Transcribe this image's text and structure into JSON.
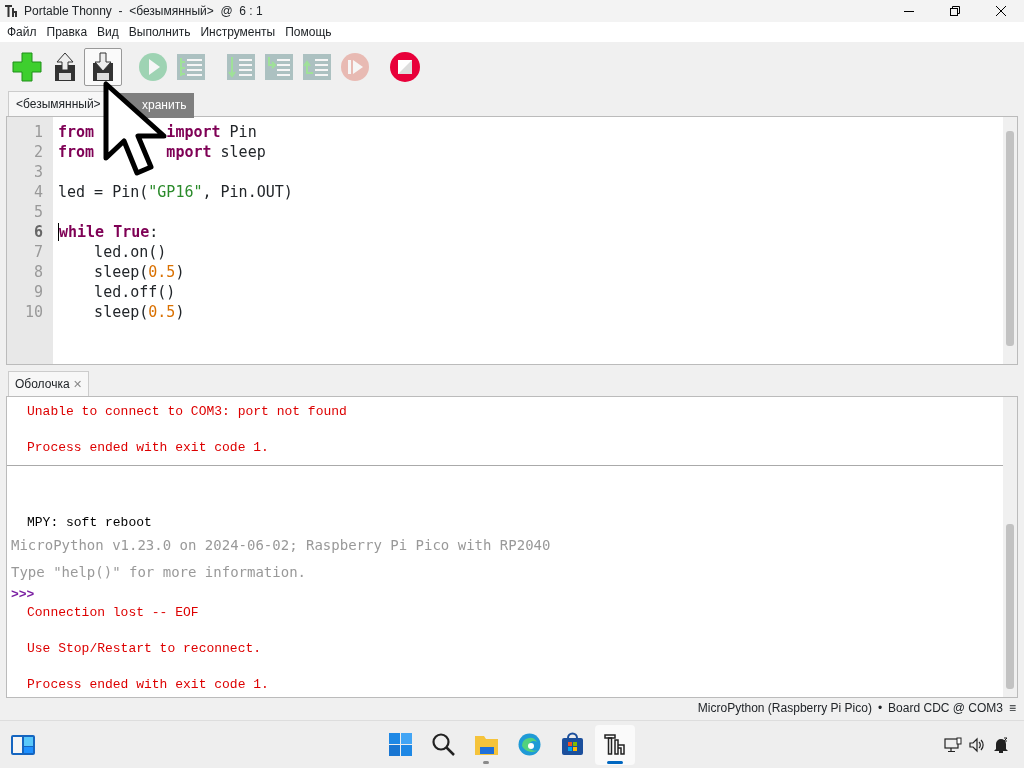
{
  "window": {
    "title": "Portable Thonny  -  <безымянный>  @  6 : 1"
  },
  "menu": [
    "Файл",
    "Правка",
    "Вид",
    "Выполнить",
    "Инструменты",
    "Помощь"
  ],
  "toolbar": [
    {
      "kind": "new",
      "disabled": false,
      "hovered": false
    },
    {
      "kind": "load",
      "disabled": false,
      "hovered": false
    },
    {
      "kind": "save",
      "disabled": false,
      "hovered": true
    },
    {
      "kind": "run",
      "disabled": true,
      "hovered": false
    },
    {
      "kind": "debug",
      "disabled": true,
      "hovered": false
    },
    {
      "kind": "step-over",
      "disabled": true,
      "hovered": false
    },
    {
      "kind": "step-into",
      "disabled": true,
      "hovered": false
    },
    {
      "kind": "step-out",
      "disabled": true,
      "hovered": false
    },
    {
      "kind": "resume",
      "disabled": true,
      "hovered": false
    },
    {
      "kind": "stop",
      "disabled": false,
      "hovered": false
    }
  ],
  "editor": {
    "tab": "<безымянный>",
    "tooltip": "хранить",
    "lines": [
      {
        "number": "1",
        "tokens": [
          {
            "kind": "keyword",
            "text": "from"
          },
          {
            "kind": "covered"
          },
          {
            "kind": "keyword",
            "text": "import"
          },
          {
            "kind": "plain",
            "text": " Pin"
          }
        ]
      },
      {
        "number": "2",
        "tokens": [
          {
            "kind": "keyword",
            "text": "from"
          },
          {
            "kind": "covered"
          },
          {
            "kind": "keyword",
            "text": "mport"
          },
          {
            "kind": "plain",
            "text": " sleep"
          }
        ]
      },
      {
        "number": "3"
      },
      {
        "number": "4",
        "tokens": [
          {
            "kind": "plain",
            "text": "led = Pin("
          },
          {
            "kind": "string",
            "text": "\"GP16\""
          },
          {
            "kind": "plain",
            "text": ", Pin.OUT)"
          }
        ]
      },
      {
        "number": "5"
      },
      {
        "number": "6",
        "current": true,
        "tokens": [
          {
            "kind": "keyword",
            "text": "while True"
          },
          {
            "kind": "plain",
            "text": ":"
          }
        ]
      },
      {
        "number": "7",
        "tokens": [
          {
            "kind": "plain",
            "text": "    led.on()"
          }
        ]
      },
      {
        "number": "8",
        "tokens": [
          {
            "kind": "plain",
            "text": "    sleep("
          },
          {
            "kind": "number",
            "text": "0.5"
          },
          {
            "kind": "plain",
            "text": ")"
          }
        ]
      },
      {
        "number": "9",
        "tokens": [
          {
            "kind": "plain",
            "text": "    led.off()"
          }
        ]
      },
      {
        "number": "10",
        "tokens": [
          {
            "kind": "plain",
            "text": "    sleep("
          },
          {
            "kind": "number",
            "text": "0.5"
          },
          {
            "kind": "plain",
            "text": ")"
          }
        ]
      }
    ]
  },
  "shell": {
    "tab": "Оболочка",
    "close": "✕",
    "lines": [
      {
        "kind": "error",
        "text": "Unable to connect to COM3: port not found"
      },
      {
        "kind": "blank"
      },
      {
        "kind": "error",
        "text": "Process ended with exit code 1."
      },
      {
        "kind": "separator"
      },
      {
        "kind": "blank"
      },
      {
        "kind": "blank"
      },
      {
        "kind": "output",
        "text": "MPY: soft reboot"
      },
      {
        "kind": "banner",
        "text": "MicroPython v1.23.0 on 2024-06-02; Raspberry Pi Pico with RP2040"
      },
      {
        "kind": "banner",
        "text": "Type \"help()\" for more information."
      },
      {
        "kind": "prompt",
        "text": ">>>"
      },
      {
        "kind": "error",
        "text": "Connection lost -- EOF"
      },
      {
        "kind": "blank"
      },
      {
        "kind": "error",
        "text": "Use Stop/Restart to reconnect."
      },
      {
        "kind": "blank"
      },
      {
        "kind": "error",
        "text": "Process ended with exit code 1."
      }
    ]
  },
  "status_bar": {
    "interpreter": "MicroPython (Raspberry Pi Pico)",
    "separator": "•",
    "port": "Board CDC @ COM3",
    "menu": "≡"
  },
  "taskbar": {
    "apps": [
      {
        "kind": "start",
        "running": false,
        "active": false
      },
      {
        "kind": "search",
        "running": false,
        "active": false
      },
      {
        "kind": "explorer",
        "running": true,
        "active": false
      },
      {
        "kind": "browser",
        "running": false,
        "active": false
      },
      {
        "kind": "store",
        "running": false,
        "active": false
      },
      {
        "kind": "thonny",
        "running": true,
        "active": true
      }
    ]
  }
}
